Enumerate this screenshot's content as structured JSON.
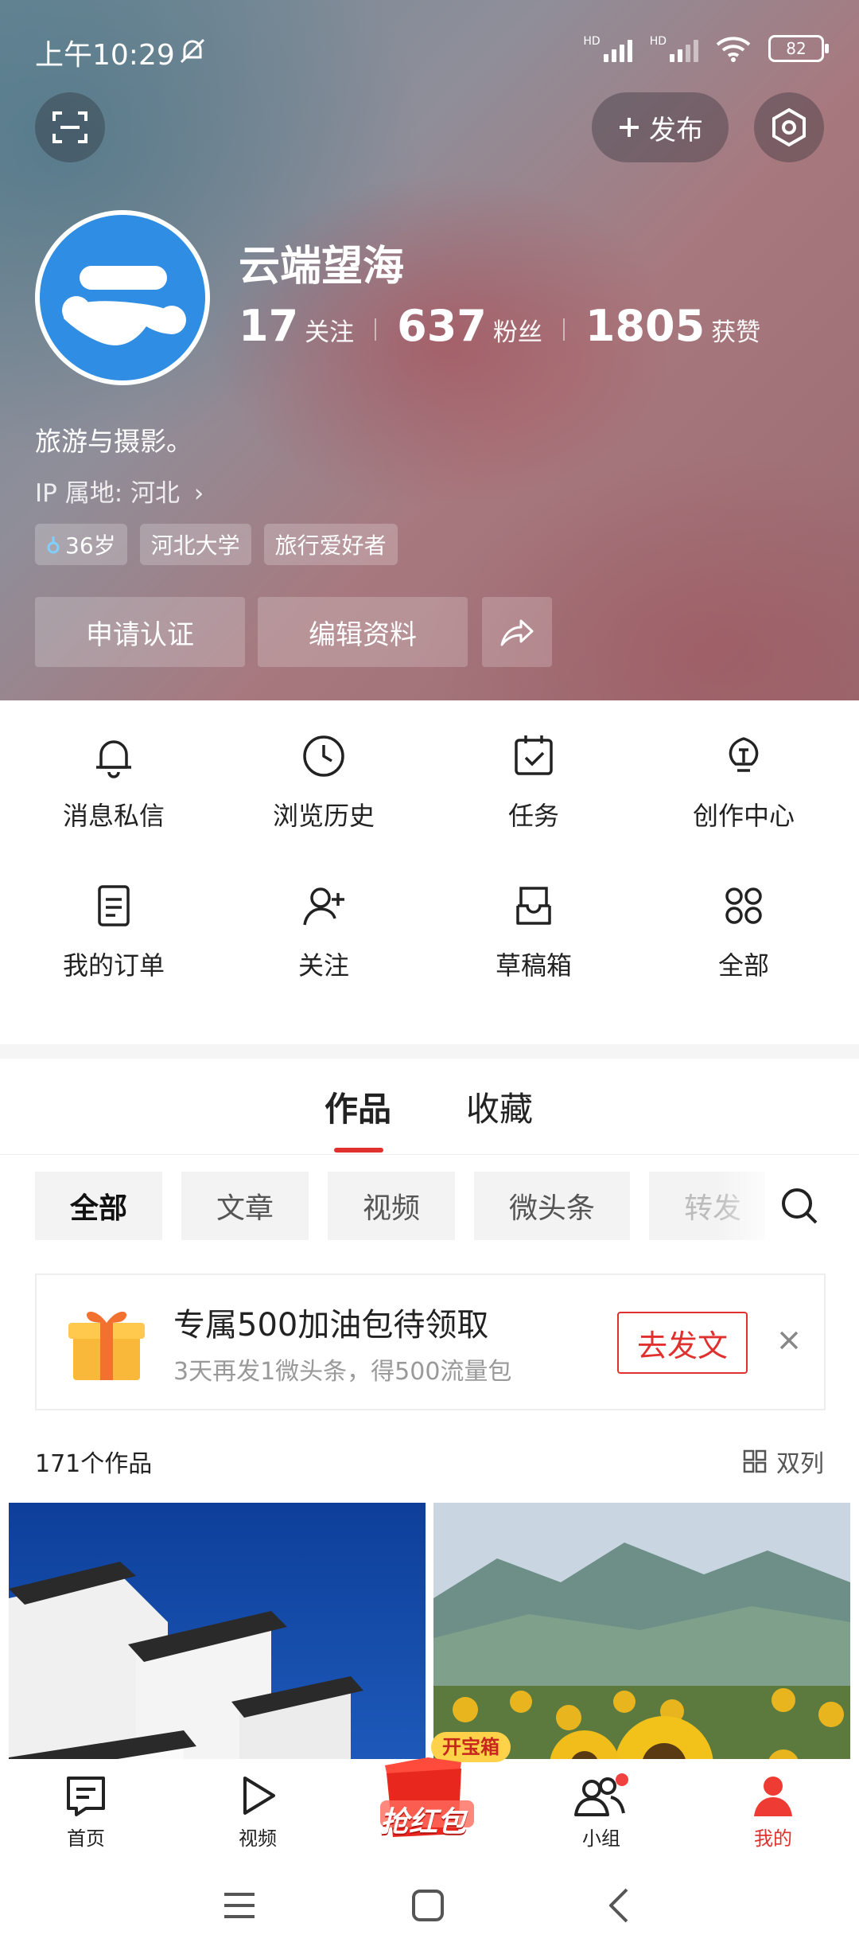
{
  "status": {
    "time": "上午10:29",
    "battery": "82",
    "signal1_label": "HD",
    "signal2_label": "HD"
  },
  "header": {
    "publish_label": "发布",
    "username": "云端望海",
    "stats": [
      {
        "value": "17",
        "label": "关注"
      },
      {
        "value": "637",
        "label": "粉丝"
      },
      {
        "value": "1805",
        "label": "获赞"
      }
    ],
    "bio": "旅游与摄影。",
    "ip": "IP 属地: 河北",
    "tags": [
      "36岁",
      "河北大学",
      "旅行爱好者"
    ],
    "buttons": {
      "verify": "申请认证",
      "edit": "编辑资料"
    },
    "avatar_color": "#2f8de4"
  },
  "grid": [
    {
      "label": "消息私信",
      "icon": "bell-icon"
    },
    {
      "label": "浏览历史",
      "icon": "clock-icon"
    },
    {
      "label": "任务",
      "icon": "calendar-check-icon"
    },
    {
      "label": "创作中心",
      "icon": "lightbulb-icon"
    },
    {
      "label": "我的订单",
      "icon": "order-icon"
    },
    {
      "label": "关注",
      "icon": "add-user-icon"
    },
    {
      "label": "草稿箱",
      "icon": "inbox-icon"
    },
    {
      "label": "全部",
      "icon": "grid-icon"
    }
  ],
  "works": {
    "tabs": [
      "作品",
      "收藏"
    ],
    "filters": [
      "全部",
      "文章",
      "视频",
      "微头条",
      "转发"
    ],
    "promo": {
      "title": "专属500加油包待领取",
      "subtitle": "3天再发1微头条，得500流量包",
      "button": "去发文"
    },
    "count": "171个作品",
    "view_mode": "双列"
  },
  "nav": {
    "items": [
      "首页",
      "视频",
      "抢红包",
      "小组",
      "我的"
    ],
    "badge": "开宝箱",
    "accent": "#e0312f"
  }
}
